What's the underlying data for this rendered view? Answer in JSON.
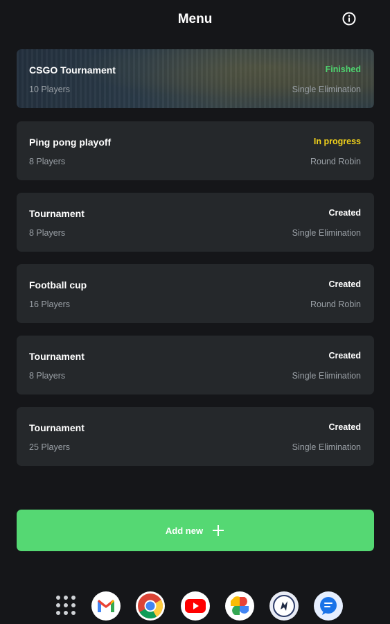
{
  "header": {
    "title": "Menu",
    "info_icon": "info-icon"
  },
  "tournaments": [
    {
      "name": "CSGO Tournament",
      "players": "10 Players",
      "status": "Finished",
      "format": "Single Elimination",
      "status_color": "#4ed36f",
      "has_image": true
    },
    {
      "name": "Ping pong playoff",
      "players": "8 Players",
      "status": "In progress",
      "format": "Round Robin",
      "status_color": "#f2d21b",
      "has_image": false
    },
    {
      "name": "Tournament",
      "players": "8 Players",
      "status": "Created",
      "format": "Single Elimination",
      "status_color": "#ffffff",
      "has_image": false
    },
    {
      "name": "Football cup",
      "players": "16 Players",
      "status": "Created",
      "format": "Round Robin",
      "status_color": "#ffffff",
      "has_image": false
    },
    {
      "name": "Tournament",
      "players": "8 Players",
      "status": "Created",
      "format": "Single Elimination",
      "status_color": "#ffffff",
      "has_image": false
    },
    {
      "name": "Tournament",
      "players": "25 Players",
      "status": "Created",
      "format": "Single Elimination",
      "status_color": "#ffffff",
      "has_image": false
    }
  ],
  "add_button": {
    "label": "Add new",
    "icon": "plus-icon",
    "color": "#55d873"
  },
  "dock": {
    "apps": [
      "app-drawer-icon",
      "gmail-icon",
      "chrome-icon",
      "youtube-icon",
      "photos-icon",
      "app-icon",
      "messages-icon"
    ]
  }
}
